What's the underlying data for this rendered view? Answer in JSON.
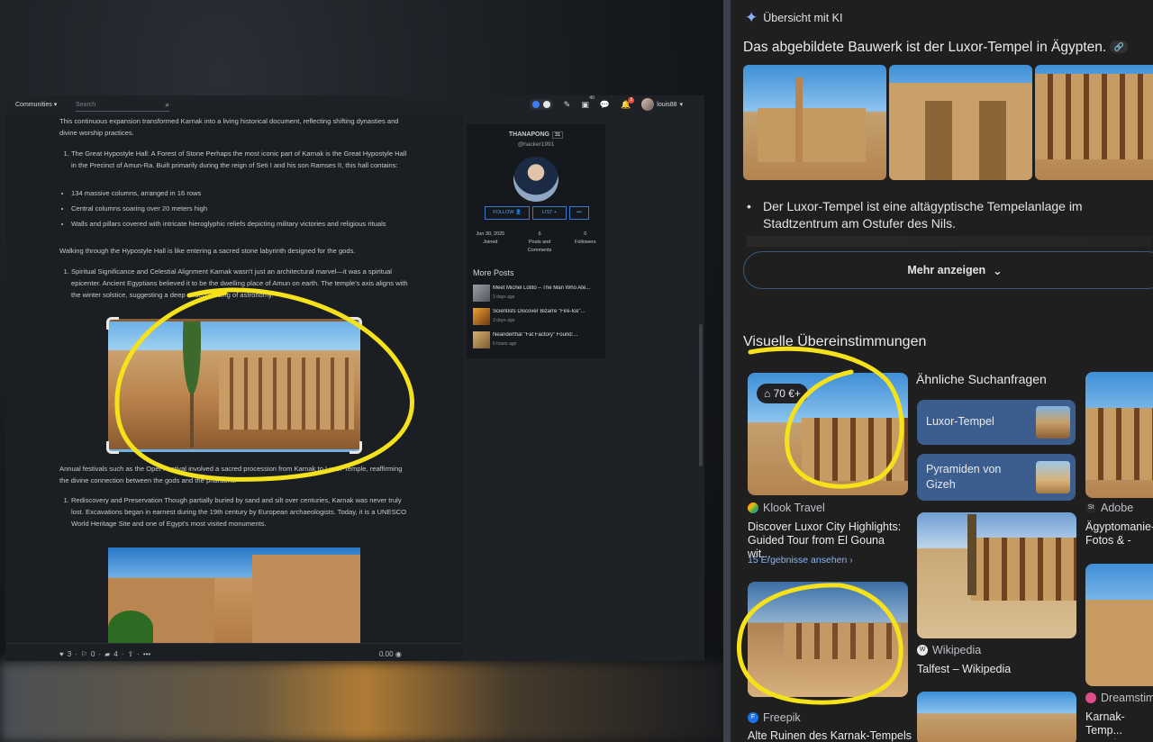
{
  "left_app": {
    "topbar": {
      "communities_label": "Communities",
      "search_placeholder": "Search",
      "messages_badge": "40",
      "notifications_badge": "3",
      "username": "louis88"
    },
    "post": {
      "para_intro": "This continuous expansion transformed Karnak into a living historical document, reflecting shifting dynasties and divine worship practices.",
      "item_hall": "The Great Hypostyle Hall: A Forest of Stone Perhaps the most iconic part of Karnak is the Great Hypostyle Hall in the Precinct of Amun-Ra. Built primarily during the reign of Seti I and his son Ramses II, this hall contains:",
      "bullets": [
        "134 massive columns, arranged in 16 rows",
        "Central columns soaring over 20 meters high",
        "Walls and pillars covered with intricate hieroglyphic reliefs depicting military victories and religious rituals"
      ],
      "para_walk": "Walking through the Hypostyle Hall is like entering a sacred stone labyrinth designed for the gods.",
      "item_spiritual": "Spiritual Significance and Celestial Alignment Karnak wasn't just an architectural marvel—it was a spiritual epicenter. Ancient Egyptians believed it to be the dwelling place of Amun on earth. The temple's axis aligns with the winter solstice, suggesting a deep understanding of astronomy.",
      "para_festival": "Annual festivals such as the Opet Festival involved a sacred procession from Karnak to Luxor Temple, reaffirming the divine connection between the gods and the pharaohs.",
      "item_rediscovery": "Rediscovery and Preservation Though partially buried by sand and silt over centuries, Karnak was never truly lost. Excavations began in earnest during the 19th century by European archaeologists. Today, it is a UNESCO World Heritage Site and one of Egypt's most visited monuments.",
      "footer": {
        "votes": "3",
        "downvotes": "0",
        "comments": "4",
        "payout": "0.00"
      }
    },
    "author": {
      "name": "THANAPONG",
      "reputation": "31",
      "handle": "@hacker1991",
      "follow_label": "FOLLOW",
      "list_label": "LIST",
      "more_label": "•••",
      "joined_value": "Jun 30, 2025",
      "joined_label": "Joined",
      "posts_value": "6",
      "posts_label": "Posts and Comments",
      "followers_value": "0",
      "followers_label": "Followers"
    },
    "more_posts": {
      "heading": "More Posts",
      "items": [
        {
          "title": "Meet Michel Lotito – The Man Who Ate...",
          "ago": "3 days ago"
        },
        {
          "title": "Scientists Discover Bizarre \"Fire-Ice\"...",
          "ago": "3 days ago"
        },
        {
          "title": "Neanderthal \"Fat Factory\" Found:...",
          "ago": "6 hours ago"
        }
      ]
    }
  },
  "lens": {
    "ai_heading": "Übersicht mit KI",
    "ai_answer": "Das abgebildete Bauwerk ist der Luxor-Tempel in Ägypten.",
    "ai_bullet": "Der Luxor-Tempel ist eine altägyptische Tempelanlage im Stadtzentrum am Ostufer des Nils.",
    "more_button": "Mehr anzeigen",
    "visual_matches_heading": "Visuelle Übereinstimmungen",
    "similar_heading": "Ähnliche Suchanfragen",
    "results": [
      {
        "price": "70 €+",
        "source": "Klook Travel",
        "title": "Discover Luxor City Highlights: Guided Tour from El Gouna wit...",
        "link": "15 Ergebnisse ansehen"
      },
      {
        "source": "Freepik",
        "title": "Alte Ruinen des Karnak-Tempels"
      },
      {
        "source": "Wikipedia",
        "title": "Talfest – Wikipedia"
      },
      {
        "source": "Adobe",
        "title": "Ägyptomanie-... Fotos & -Vide..."
      },
      {
        "source": "Dreamstime",
        "title": "Karnak-Temp... Luxuriösem Ä..."
      }
    ],
    "similar_chips": [
      {
        "label": "Luxor-Tempel"
      },
      {
        "label": "Pyramiden von Gizeh"
      }
    ]
  },
  "colors": {
    "annotation_yellow": "#f5e21b",
    "lens_accent": "#8ab4f8",
    "chip_bg": "#3c5e8e"
  }
}
